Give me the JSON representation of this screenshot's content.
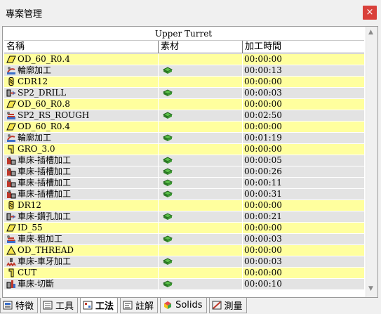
{
  "window": {
    "title": "專案管理",
    "close_label": "×"
  },
  "group": {
    "header": "Upper Turret"
  },
  "columns": {
    "name": "名稱",
    "material": "素材",
    "time": "加工時間"
  },
  "rows": [
    {
      "name": "OD_60_R0.4",
      "icon": "insert-tool-icon",
      "material": false,
      "time": "00:00:00",
      "style": "yellow"
    },
    {
      "name": "輪廓加工",
      "icon": "contour-op-icon",
      "material": true,
      "time": "00:00:13",
      "style": "gray"
    },
    {
      "name": "CDR12",
      "icon": "drill-tool-icon",
      "material": false,
      "time": "00:00:00",
      "style": "yellow"
    },
    {
      "name": "SP2_DRILL",
      "icon": "drill-op-icon",
      "material": true,
      "time": "00:00:03",
      "style": "gray"
    },
    {
      "name": "OD_60_R0.8",
      "icon": "insert-tool-icon",
      "material": false,
      "time": "00:00:00",
      "style": "yellow"
    },
    {
      "name": "SP2_RS_ROUGH",
      "icon": "rough-op-icon",
      "material": true,
      "time": "00:02:50",
      "style": "gray"
    },
    {
      "name": "OD_60_R0.4",
      "icon": "insert-tool-icon",
      "material": false,
      "time": "00:00:00",
      "style": "yellow"
    },
    {
      "name": "輪廓加工",
      "icon": "contour-op-icon",
      "material": true,
      "time": "00:01:19",
      "style": "gray"
    },
    {
      "name": "GRO_3.0",
      "icon": "groove-tool-icon",
      "material": false,
      "time": "00:00:00",
      "style": "yellow"
    },
    {
      "name": "車床-插槽加工",
      "icon": "groove-op-icon",
      "material": true,
      "time": "00:00:05",
      "style": "gray"
    },
    {
      "name": "車床-插槽加工",
      "icon": "groove-op-icon",
      "material": true,
      "time": "00:00:26",
      "style": "gray"
    },
    {
      "name": "車床-插槽加工",
      "icon": "groove-op-icon",
      "material": true,
      "time": "00:00:11",
      "style": "gray"
    },
    {
      "name": "車床-插槽加工",
      "icon": "groove-op-icon",
      "material": true,
      "time": "00:00:31",
      "style": "gray"
    },
    {
      "name": "DR12",
      "icon": "drill-tool-icon",
      "material": false,
      "time": "00:00:00",
      "style": "yellow"
    },
    {
      "name": "車床-鑽孔加工",
      "icon": "drill-op-icon",
      "material": true,
      "time": "00:00:21",
      "style": "gray"
    },
    {
      "name": "ID_55",
      "icon": "insert-tool-icon",
      "material": false,
      "time": "00:00:00",
      "style": "yellow"
    },
    {
      "name": "車床-粗加工",
      "icon": "rough-op-icon",
      "material": true,
      "time": "00:00:03",
      "style": "gray"
    },
    {
      "name": "OD_THREAD",
      "icon": "thread-tool-icon",
      "material": false,
      "time": "00:00:00",
      "style": "yellow"
    },
    {
      "name": "車床-車牙加工",
      "icon": "thread-op-icon",
      "material": true,
      "time": "00:00:03",
      "style": "gray"
    },
    {
      "name": "CUT",
      "icon": "cutoff-tool-icon",
      "material": false,
      "time": "00:00:00",
      "style": "yellow"
    },
    {
      "name": "車床-切斷",
      "icon": "cutoff-op-icon",
      "material": true,
      "time": "00:00:10",
      "style": "gray"
    }
  ],
  "tabs": [
    {
      "label": "特徵",
      "icon": "features-icon",
      "active": false
    },
    {
      "label": "工具",
      "icon": "tools-icon",
      "active": false
    },
    {
      "label": "工法",
      "icon": "process-icon",
      "active": true
    },
    {
      "label": "註解",
      "icon": "annotation-icon",
      "active": false
    },
    {
      "label": "Solids",
      "icon": "solids-icon",
      "active": false
    },
    {
      "label": "測量",
      "icon": "measure-icon",
      "active": false
    }
  ],
  "colors": {
    "tool_row": "#ffff9e",
    "op_row": "#e3e3e3",
    "close": "#d9403a"
  }
}
